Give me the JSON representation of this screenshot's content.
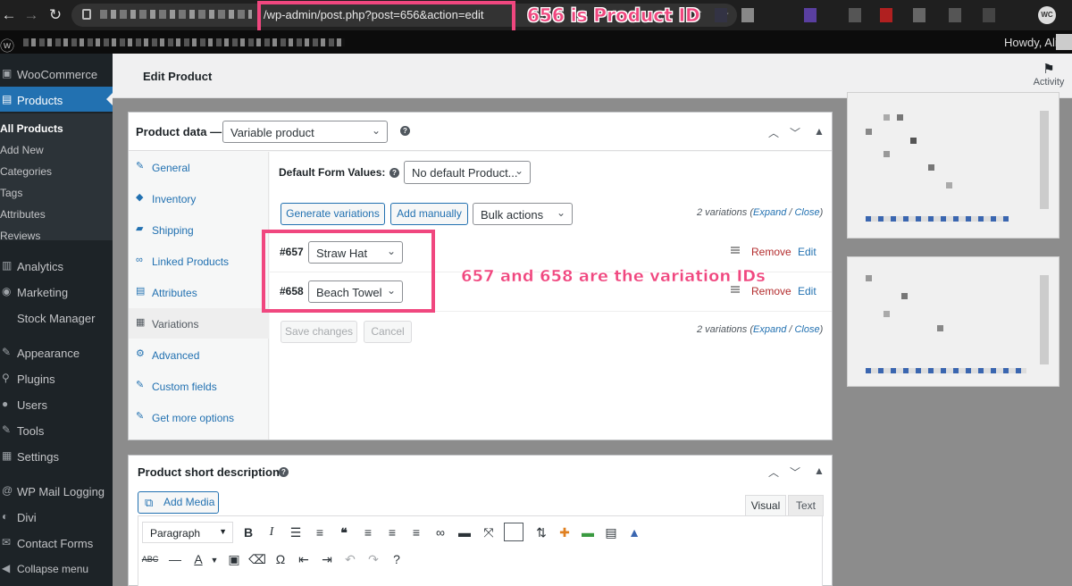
{
  "browser": {
    "url": "/wp-admin/post.php?post=656&action=edit",
    "annotation": "656 is Product ID",
    "badge": "WC"
  },
  "admin_bar": {
    "greeting": "Howdy, Ali"
  },
  "sidebar": {
    "items": [
      {
        "label": "WooCommerce",
        "icon": "woo-icon"
      },
      {
        "label": "Products",
        "icon": "products-icon"
      },
      {
        "label": "Analytics",
        "icon": "analytics-icon"
      },
      {
        "label": "Marketing",
        "icon": "marketing-icon"
      },
      {
        "label": "Stock Manager",
        "icon": "stock-icon"
      },
      {
        "label": "Appearance",
        "icon": "appearance-icon"
      },
      {
        "label": "Plugins",
        "icon": "plugins-icon"
      },
      {
        "label": "Users",
        "icon": "users-icon"
      },
      {
        "label": "Tools",
        "icon": "tools-icon"
      },
      {
        "label": "Settings",
        "icon": "settings-icon"
      },
      {
        "label": "WP Mail Logging",
        "icon": "mail-log-icon"
      },
      {
        "label": "Divi",
        "icon": "divi-icon"
      },
      {
        "label": "Contact Forms",
        "icon": "contact-forms-icon"
      },
      {
        "label": "Collapse menu",
        "icon": "collapse-icon"
      }
    ],
    "submenu": [
      "All Products",
      "Add New",
      "Categories",
      "Tags",
      "Attributes",
      "Reviews"
    ]
  },
  "header": {
    "title": "Edit Product",
    "activity": "Activity"
  },
  "product_data": {
    "title": "Product data —",
    "type": "Variable product",
    "tabs": [
      "General",
      "Inventory",
      "Shipping",
      "Linked Products",
      "Attributes",
      "Variations",
      "Advanced",
      "Custom fields",
      "Get more options"
    ],
    "default_form_label": "Default Form Values:",
    "default_form_value": "No default Product...",
    "generate_btn": "Generate variations",
    "add_manually_btn": "Add manually",
    "bulk_actions": "Bulk actions",
    "count_text": "2 variations",
    "expand": "Expand",
    "close": "Close",
    "variations": [
      {
        "id": "#657",
        "name": "Straw Hat",
        "remove": "Remove",
        "edit": "Edit"
      },
      {
        "id": "#658",
        "name": "Beach Towel",
        "remove": "Remove",
        "edit": "Edit"
      }
    ],
    "save_btn": "Save changes",
    "cancel_btn": "Cancel",
    "annotation": "657 and 658 are the variation IDs"
  },
  "short_description": {
    "title": "Product short description",
    "add_media": "Add Media",
    "visual_tab": "Visual",
    "text_tab": "Text",
    "format": "Paragraph"
  },
  "colors": {
    "accent": "#2271b1",
    "annotation": "#f0477f",
    "admin_dark": "#1d2327",
    "remove": "#b32d2e"
  }
}
